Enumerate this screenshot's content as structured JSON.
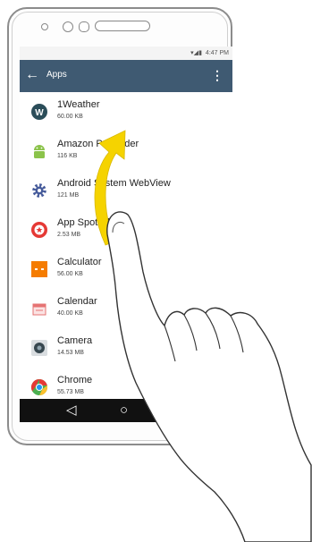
{
  "status_bar": {
    "time": "4:47 PM"
  },
  "app_bar": {
    "title": "Apps"
  },
  "apps": [
    {
      "name": "1Weather",
      "size": "60.00 KB",
      "icon": "weather-icon",
      "color": "#2b4d59"
    },
    {
      "name": "Amazon Preloader",
      "size": "116 KB",
      "icon": "android-icon",
      "color": "#8bc34a"
    },
    {
      "name": "Android System WebView",
      "size": "121 MB",
      "icon": "gear-icon",
      "color": "#455a9a"
    },
    {
      "name": "App Spotlight",
      "size": "2.53 MB",
      "icon": "star-badge-icon",
      "color": "#e53935"
    },
    {
      "name": "Calculator",
      "size": "56.00 KB",
      "icon": "calculator-icon",
      "color": "#f57c00"
    },
    {
      "name": "Calendar",
      "size": "40.00 KB",
      "icon": "calendar-icon",
      "color": "#e57373"
    },
    {
      "name": "Camera",
      "size": "14.53 MB",
      "icon": "camera-icon",
      "color": "#37474f"
    },
    {
      "name": "Chrome",
      "size": "55.73 MB",
      "icon": "chrome-icon",
      "color": "#4caf50"
    }
  ],
  "nav_bar": {
    "back": "◁",
    "home": "○"
  },
  "gesture": {
    "type": "swipe-up",
    "arrow_color": "#f5d300"
  }
}
